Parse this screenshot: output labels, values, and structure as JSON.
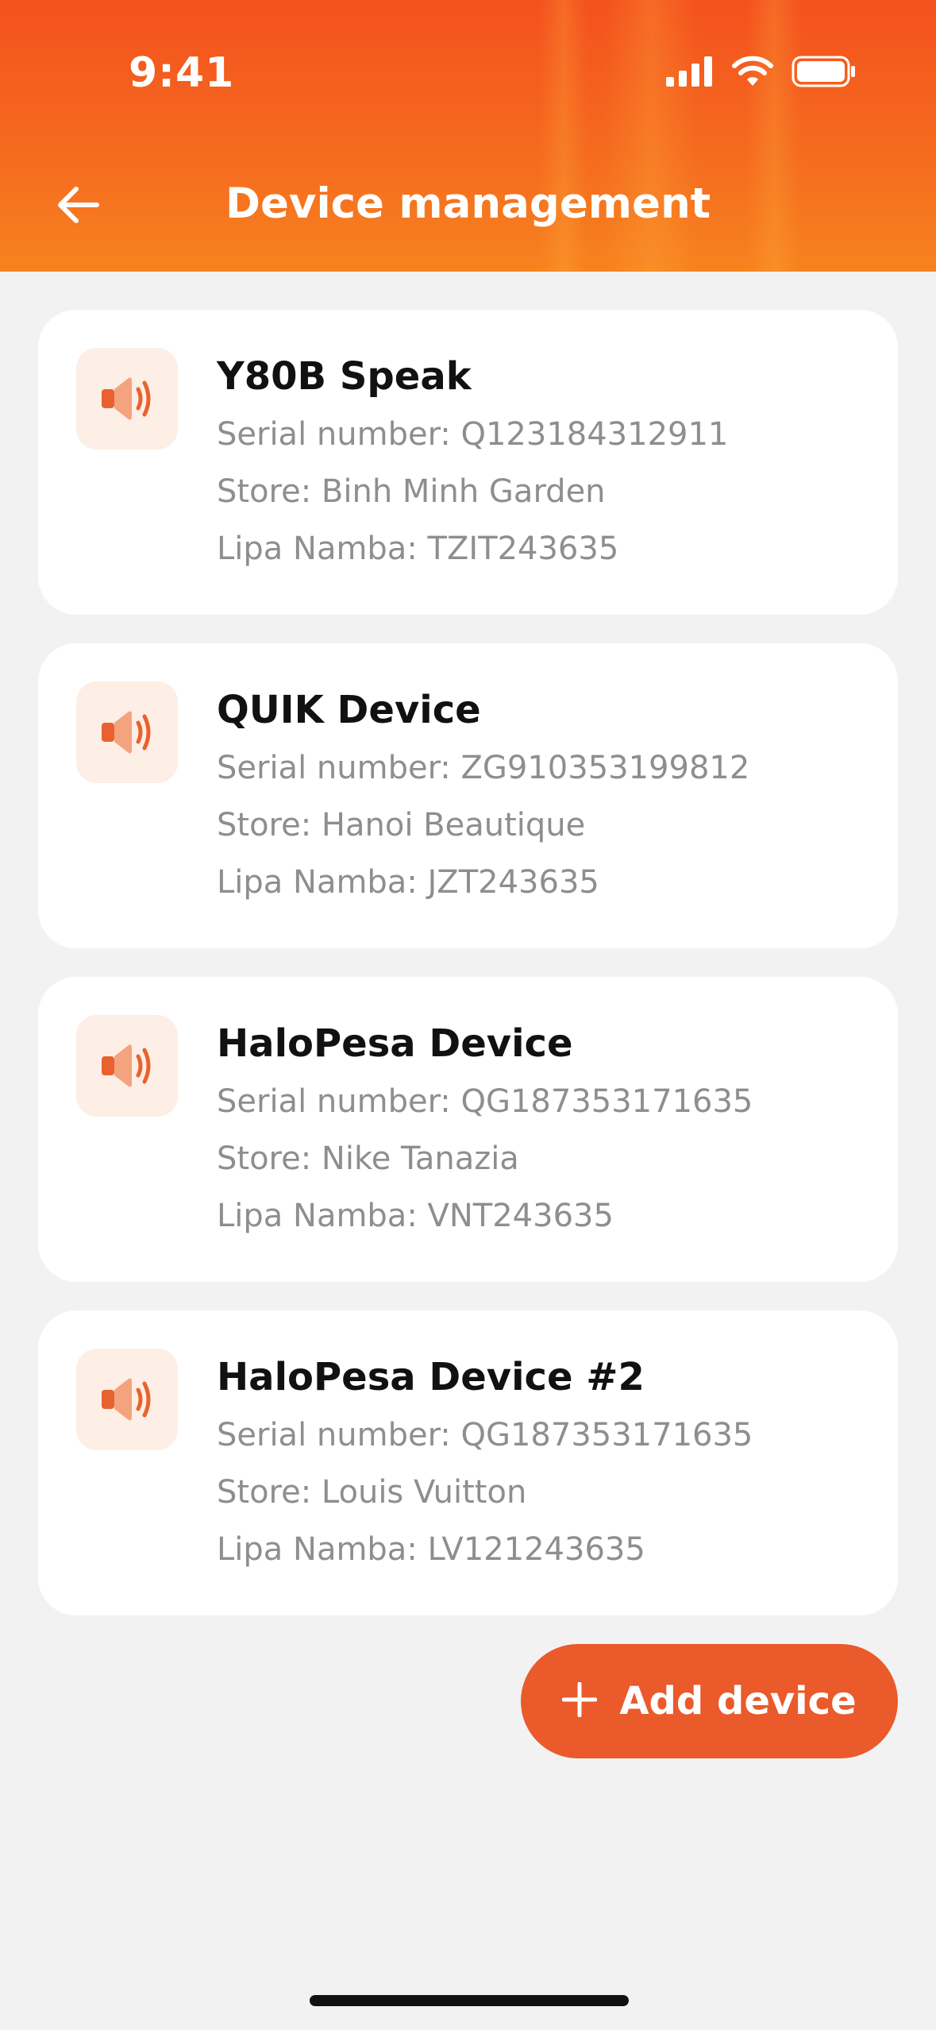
{
  "status_bar": {
    "time": "9:41"
  },
  "header": {
    "title": "Device management",
    "back_icon": "arrow-left-icon"
  },
  "devices": [
    {
      "name": "Y80B Speak",
      "serial": "Serial number: Q123184312911",
      "store": "Store: Binh Minh Garden",
      "lipa": "Lipa Namba: TZIT243635",
      "icon": "speaker-icon"
    },
    {
      "name": "QUIK Device",
      "serial": "Serial number: ZG910353199812",
      "store": "Store: Hanoi Beautique",
      "lipa": "Lipa Namba: JZT243635",
      "icon": "speaker-icon"
    },
    {
      "name": "HaloPesa Device",
      "serial": "Serial number: QG187353171635",
      "store": "Store: Nike Tanazia",
      "lipa": "Lipa Namba: VNT243635",
      "icon": "speaker-icon"
    },
    {
      "name": "HaloPesa Device #2",
      "serial": "Serial number: QG187353171635",
      "store": "Store: Louis Vuitton",
      "lipa": "Lipa Namba: LV121243635",
      "icon": "speaker-icon"
    }
  ],
  "add_button": {
    "label": "Add device",
    "icon": "plus-icon"
  },
  "colors": {
    "header_top": "#f4511e",
    "header_bottom": "#f7821f",
    "accent": "#ea5a2a",
    "icon_bg": "#fdeee6",
    "background": "#f2f2f2"
  }
}
